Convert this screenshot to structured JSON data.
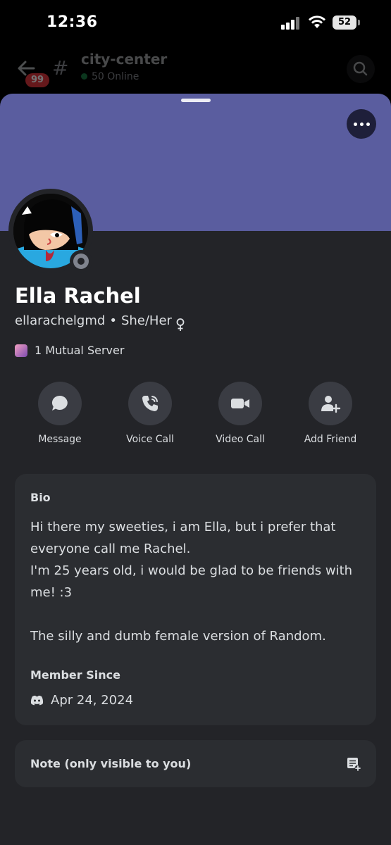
{
  "status_bar": {
    "time": "12:36",
    "battery": "52"
  },
  "channel": {
    "name": "city-center",
    "online": "50 Online",
    "unread_badge": "99"
  },
  "profile": {
    "display_name": "Ella Rachel",
    "username": "ellarachelgmd",
    "pronouns": "She/Her",
    "mutual": "1 Mutual Server",
    "status_color": "#80848e",
    "banner_color": "#5a5d9f"
  },
  "actions": [
    {
      "label": "Message",
      "icon": "chat-bubble-icon"
    },
    {
      "label": "Voice Call",
      "icon": "phone-icon"
    },
    {
      "label": "Video Call",
      "icon": "video-camera-icon"
    },
    {
      "label": "Add Friend",
      "icon": "add-friend-icon"
    }
  ],
  "bio": {
    "title": "Bio",
    "line1": "Hi there my sweeties, i am Ella, but i prefer that everyone call me Rachel.",
    "line2": "I'm 25 years old, i would be glad to be friends with me! :3",
    "line3": "The silly and dumb female version of Random.",
    "member_since_title": "Member Since",
    "member_since_date": "Apr 24, 2024"
  },
  "note": {
    "label": "Note (only visible to you)"
  }
}
